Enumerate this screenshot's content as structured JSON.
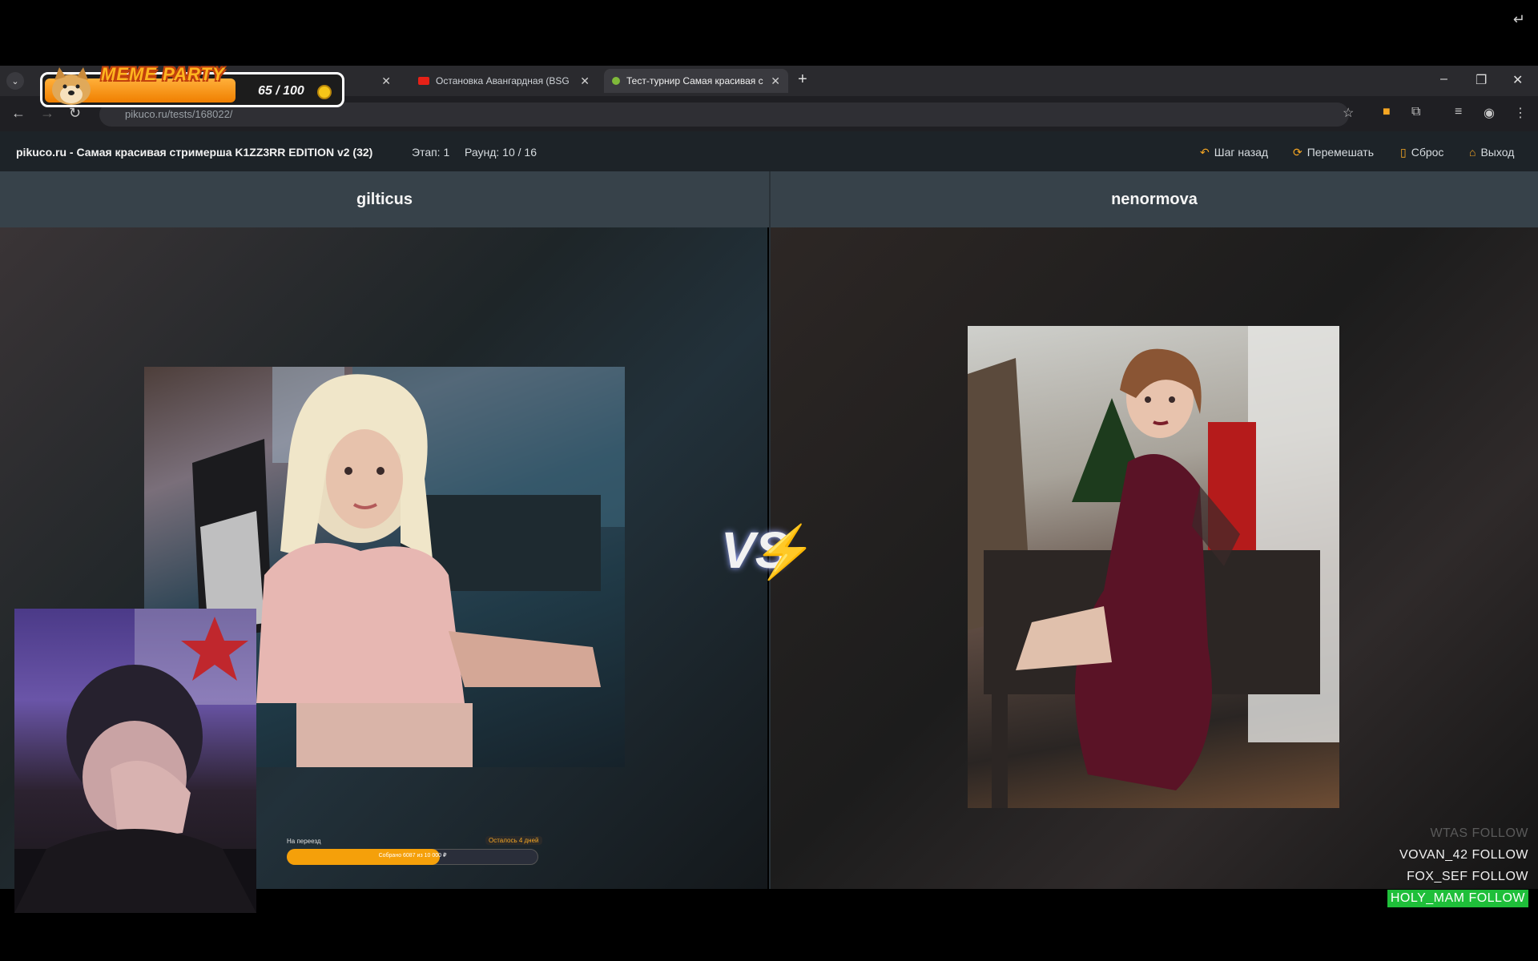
{
  "browser": {
    "tabs": [
      {
        "label": "Остановка Авангардная (BSG",
        "active": false
      },
      {
        "label": "Тест-турнир Самая красивая с",
        "active": true
      }
    ],
    "url": "pikuco.ru/tests/168022/"
  },
  "overlay": {
    "meme_party": {
      "title": "MEME PARTY",
      "count": "65 / 100",
      "progress": 0.65
    },
    "exit_icon": "↵"
  },
  "site": {
    "title": "pikuco.ru - Самая красивая стримерша K1ZZ3RR EDITION v2 (32)",
    "stage": "Этап: 1",
    "round": "Раунд: 10 / 16",
    "actions": {
      "back": "Шаг назад",
      "shuffle": "Перемешать",
      "reset": "Сброс",
      "exit": "Выход"
    }
  },
  "contest": {
    "left_name": "gilticus",
    "right_name": "nenormova",
    "vs_label": "VS"
  },
  "donation_goal": {
    "label": "На переезд",
    "remaining": "Осталось 4 дней",
    "text": "Собрано 6087 из 10 000 ₽",
    "progress": 0.6087
  },
  "follows": [
    {
      "name": "WTAS",
      "action": "FOLLOW",
      "style": "faded"
    },
    {
      "name": "VOVAN_42",
      "action": "FOLLOW",
      "style": "normal"
    },
    {
      "name": "FOX_SEF",
      "action": "FOLLOW",
      "style": "normal"
    },
    {
      "name": "HOLY_MAM",
      "action": "FOLLOW",
      "style": "highlight"
    }
  ],
  "colors": {
    "accent_orange": "#f5a623",
    "follow_highlight": "#1fbf3a",
    "namebar": "#37424a"
  }
}
